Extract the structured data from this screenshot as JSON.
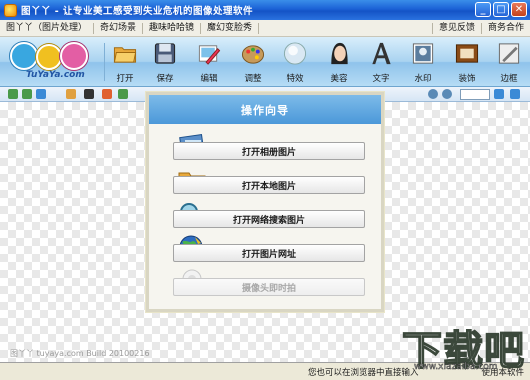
{
  "window": {
    "title": "图丫丫 - 让专业美工感受到失业危机的图像处理软件",
    "minimize_glyph": "_",
    "maximize_glyph": "□",
    "close_glyph": "✕"
  },
  "menu": {
    "left": [
      "图丫丫（图片处理）",
      "奇幻场景",
      "趣味哈哈镜",
      "魔幻变脸秀"
    ],
    "right": [
      "意见反馈",
      "商务合作"
    ]
  },
  "logo": {
    "text": "TuYaYa.com"
  },
  "ribbon": {
    "buttons": [
      {
        "label": "打开",
        "icon": "folder-open-icon"
      },
      {
        "label": "保存",
        "icon": "floppy-disk-icon"
      },
      {
        "label": "编辑",
        "icon": "edit-photo-icon"
      },
      {
        "label": "调整",
        "icon": "palette-icon"
      },
      {
        "label": "特效",
        "icon": "effects-orb-icon"
      },
      {
        "label": "美容",
        "icon": "beauty-face-icon"
      },
      {
        "label": "文字",
        "icon": "text-a-icon"
      },
      {
        "label": "水印",
        "icon": "watermark-icon"
      },
      {
        "label": "装饰",
        "icon": "decoration-frame-icon"
      },
      {
        "label": "边框",
        "icon": "border-icon"
      }
    ]
  },
  "wizard": {
    "title": "操作向导",
    "items": [
      {
        "label": "打开相册图片",
        "icon": "photo-album-icon",
        "enabled": true
      },
      {
        "label": "打开本地图片",
        "icon": "local-folder-icon",
        "enabled": true
      },
      {
        "label": "打开网络搜索图片",
        "icon": "web-search-icon",
        "enabled": true
      },
      {
        "label": "打开图片网址",
        "icon": "globe-url-icon",
        "enabled": true
      },
      {
        "label": "摄像头即时拍",
        "icon": "webcam-icon",
        "enabled": false
      }
    ]
  },
  "canvas": {
    "footer": "图丫丫 tuyaya.com Build 20100216"
  },
  "status": {
    "text": "您也可以在浏览器中直接输入",
    "right": "使用本软件"
  },
  "watermark": {
    "big": "下载吧",
    "small": "www.xiazaiba.com"
  },
  "colors": {
    "title_bar": "#1b62d6",
    "ribbon": "#a9d3f0",
    "wizard_head": "#4b98d9"
  }
}
